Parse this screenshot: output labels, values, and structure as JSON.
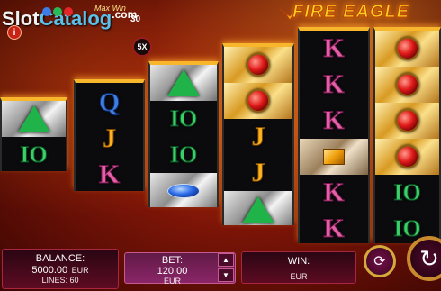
{
  "game": {
    "title": "FIRE EAGLE"
  },
  "watermark": {
    "part1": "Slot",
    "part2": "Catalog",
    "part3": ".com"
  },
  "jackpot": {
    "max_win_label": "Max Win",
    "max_win_value": "30",
    "multiplier": "5X",
    "info": "i"
  },
  "reels": [
    {
      "symbols": [
        "emerald",
        "10"
      ]
    },
    {
      "symbols": [
        "Q",
        "J",
        "K"
      ]
    },
    {
      "symbols": [
        "emerald",
        "10",
        "10",
        "sapphire"
      ]
    },
    {
      "symbols": [
        "ruby",
        "ruby",
        "J",
        "J",
        "emerald"
      ]
    },
    {
      "symbols": [
        "K",
        "K",
        "K",
        "topaz",
        "K",
        "K"
      ]
    },
    {
      "symbols": [
        "ruby",
        "ruby",
        "ruby",
        "ruby",
        "10",
        "10"
      ]
    }
  ],
  "balance": {
    "label": "BALANCE:",
    "value": "5000.00",
    "currency": "EUR",
    "lines_label": "LINES: 60"
  },
  "bet": {
    "label": "BET:",
    "value": "120.00",
    "currency": "EUR",
    "up": "▲",
    "down": "▼"
  },
  "win": {
    "label": "WIN:",
    "currency": "EUR"
  },
  "controls": {
    "autoplay_icon": "refresh-icon",
    "spin_icon": "spin-icon"
  },
  "colors": {
    "accent_gold": "#f7b62b",
    "brand_red": "#b4300d",
    "panel": "#5d0b22"
  }
}
